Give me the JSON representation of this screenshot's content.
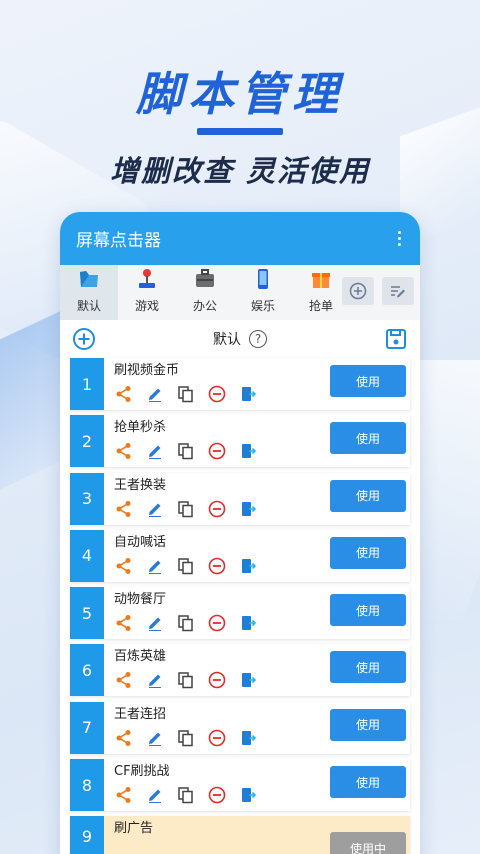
{
  "hero": {
    "title": "脚本管理",
    "subtitle": "增删改查 灵活使用"
  },
  "app": {
    "title": "屏幕点击器",
    "accent": "#29a0ec"
  },
  "tabs": [
    {
      "label": "默认",
      "icon": "folder-icon",
      "active": true
    },
    {
      "label": "游戏",
      "icon": "joystick-icon",
      "active": false
    },
    {
      "label": "办公",
      "icon": "briefcase-icon",
      "active": false
    },
    {
      "label": "娱乐",
      "icon": "phone-icon",
      "active": false
    },
    {
      "label": "抢单",
      "icon": "gift-icon",
      "active": false
    }
  ],
  "group": {
    "name": "默认",
    "help": "?"
  },
  "scripts": [
    {
      "num": "1",
      "name": "刷视频金币",
      "action": "使用"
    },
    {
      "num": "2",
      "name": "抢单秒杀",
      "action": "使用"
    },
    {
      "num": "3",
      "name": "王者换装",
      "action": "使用"
    },
    {
      "num": "4",
      "name": "自动喊话",
      "action": "使用"
    },
    {
      "num": "5",
      "name": "动物餐厅",
      "action": "使用"
    },
    {
      "num": "6",
      "name": "百炼英雄",
      "action": "使用"
    },
    {
      "num": "7",
      "name": "王者连招",
      "action": "使用"
    },
    {
      "num": "8",
      "name": "CF刷挑战",
      "action": "使用"
    }
  ],
  "last_script": {
    "num": "9",
    "name": "刷广告",
    "action": "使用中"
  }
}
